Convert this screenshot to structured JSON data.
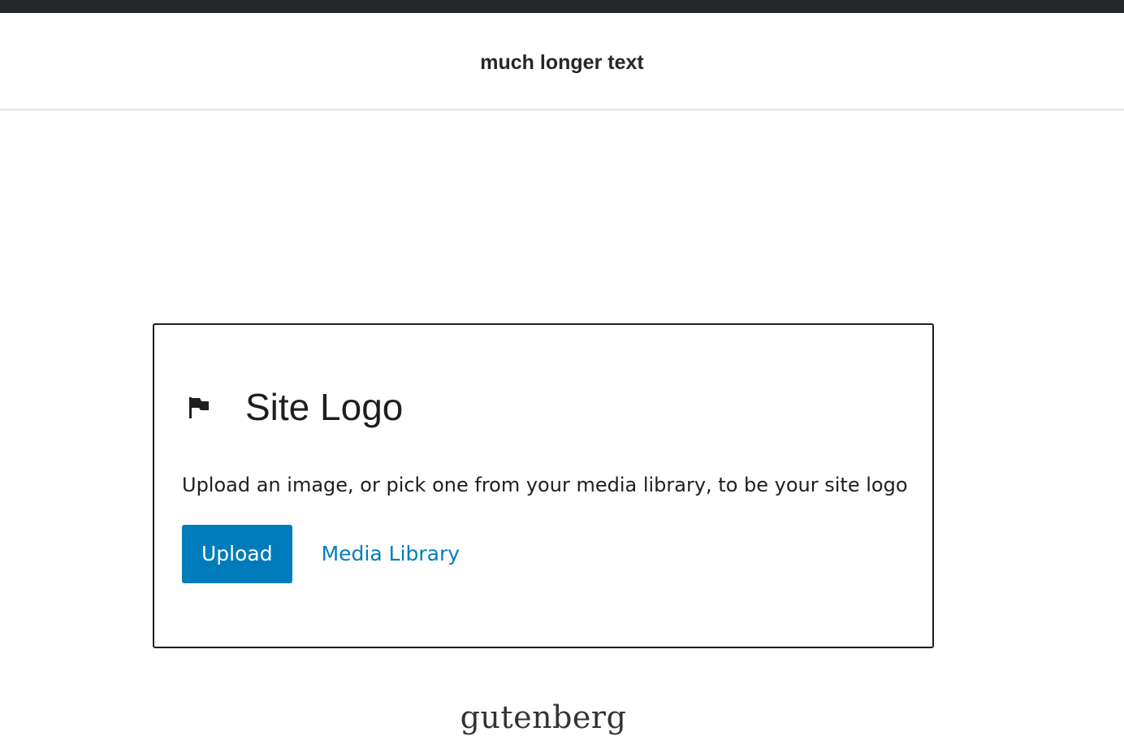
{
  "header": {
    "title": "much longer text"
  },
  "site_logo_block": {
    "icon": "flag-icon",
    "title": "Site Logo",
    "instructions": "Upload an image, or pick one from your media library, to be your site logo",
    "upload_label": "Upload",
    "media_library_label": "Media Library"
  },
  "footer": {
    "site_title": "gutenberg"
  },
  "colors": {
    "topbar": "#23282d",
    "accent": "#007cba",
    "text": "#1e1e1e"
  }
}
